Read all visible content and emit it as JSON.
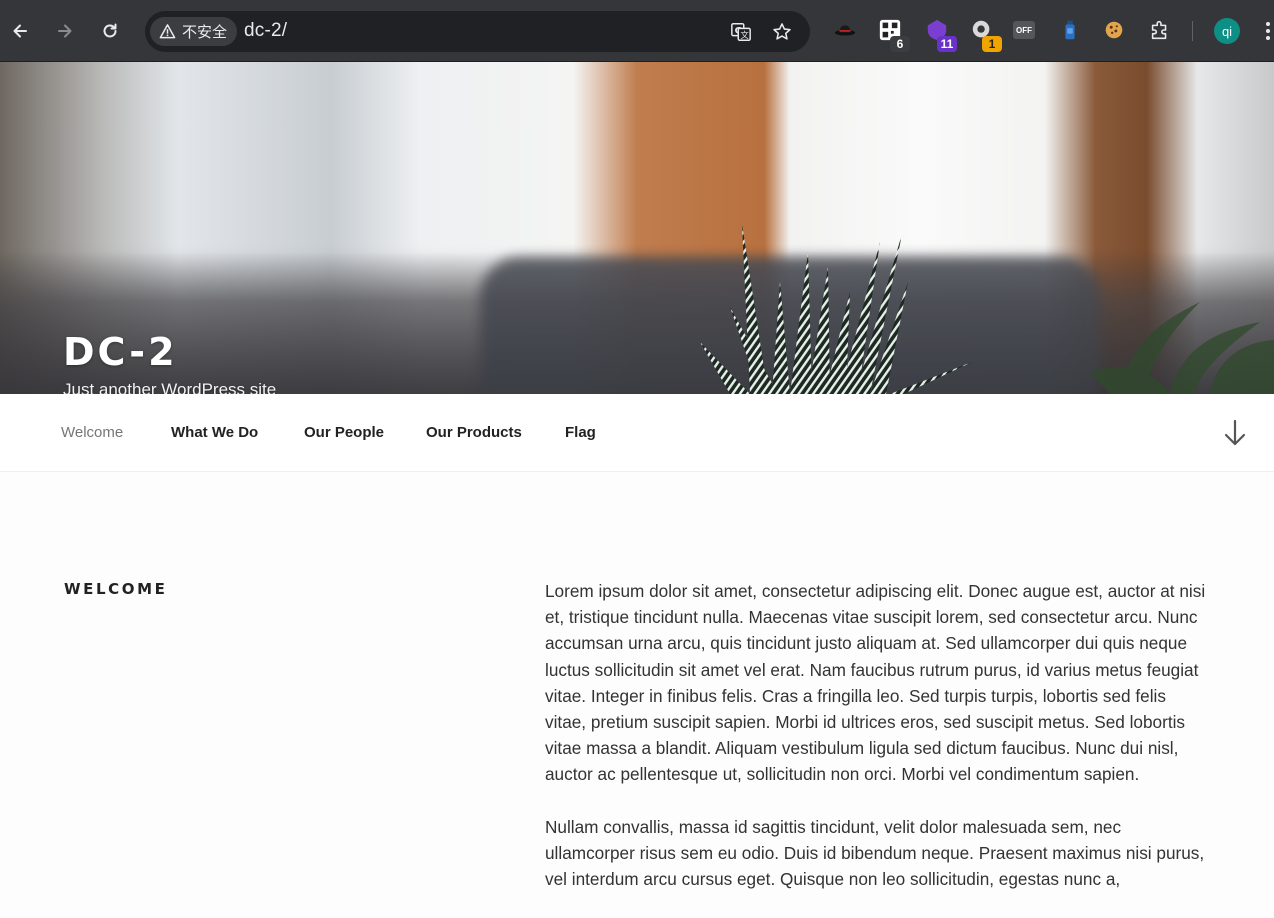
{
  "browser": {
    "security_label": "不安全",
    "url": "dc-2/",
    "extensions": [
      {
        "icon": "hat-icon",
        "badge": ""
      },
      {
        "icon": "qr-scanner-icon",
        "badge": "6"
      },
      {
        "icon": "purple-shield-icon",
        "badge": "11"
      },
      {
        "icon": "grey-circle-extension-icon",
        "badge": "1"
      },
      {
        "icon": "off-toggle-icon",
        "label": "OFF",
        "badge": ""
      },
      {
        "icon": "bottle-icon",
        "badge": ""
      },
      {
        "icon": "cookie-icon",
        "badge": ""
      },
      {
        "icon": "puzzle-icon",
        "badge": ""
      }
    ],
    "profile_initials": "qi"
  },
  "site": {
    "title": "DC-2",
    "description": "Just another WordPress site"
  },
  "nav": {
    "items": [
      {
        "label": "Welcome",
        "current": true
      },
      {
        "label": "What We Do",
        "current": false
      },
      {
        "label": "Our People",
        "current": false
      },
      {
        "label": "Our Products",
        "current": false
      },
      {
        "label": "Flag",
        "current": false
      }
    ]
  },
  "page": {
    "heading": "WELCOME",
    "paragraphs": [
      "Lorem ipsum dolor sit amet, consectetur adipiscing elit. Donec augue est, auctor at nisi et, tristique tincidunt nulla. Maecenas vitae suscipit lorem, sed consectetur arcu. Nunc accumsan urna arcu, quis tincidunt justo aliquam at. Sed ullamcorper dui quis neque luctus sollicitudin sit amet vel erat. Nam faucibus rutrum purus, id varius metus feugiat vitae. Integer in finibus felis. Cras a fringilla leo. Sed turpis turpis, lobortis sed felis vitae, pretium suscipit sapien. Morbi id ultrices eros, sed suscipit metus. Sed lobortis vitae massa a blandit. Aliquam vestibulum ligula sed dictum faucibus. Nunc dui nisl, auctor ac pellentesque ut, sollicitudin non orci. Morbi vel condimentum sapien.",
      "Nullam convallis, massa id sagittis tincidunt, velit dolor malesuada sem, nec ullamcorper risus sem eu odio. Duis id bibendum neque. Praesent maximus nisi purus, vel interdum arcu cursus eget. Quisque non leo sollicitudin, egestas nunc a,"
    ]
  },
  "colors": {
    "chrome_bg": "#35363a",
    "omnibox_bg": "#202124",
    "nav_current": "#767676",
    "nav_text": "#222222",
    "body_text": "#333333"
  }
}
